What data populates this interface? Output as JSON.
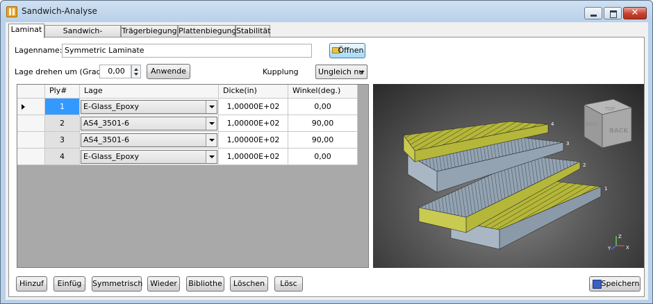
{
  "window": {
    "title": "Sandwich-Analyse",
    "icon": "app-icon",
    "controls": [
      "minimize-icon",
      "maximize-icon",
      "close-icon"
    ]
  },
  "tabs": [
    {
      "label": "Laminat",
      "active": true
    },
    {
      "label": "Sandwich-Geometrie",
      "active": false
    },
    {
      "label": "Trägerbiegung",
      "active": false
    },
    {
      "label": "Plattenbiegung",
      "active": false
    },
    {
      "label": "Stabilität",
      "active": false
    }
  ],
  "form": {
    "lagenname_label": "Lagenname:",
    "lagenname_value": "Symmetric Laminate",
    "open_button": "Öffnen",
    "rotate_label": "Lage drehen um (Grad)",
    "rotate_value": "0,00",
    "apply_button": "Anwende",
    "kupplung_label": "Kupplung",
    "kupplung_value": "Ungleich nu"
  },
  "table": {
    "columns": [
      "Ply#",
      "Lage",
      "Dicke(in)",
      "Winkel(deg.)"
    ],
    "rows": [
      {
        "ply": "1",
        "lage": "E-Glass_Epoxy",
        "dicke": "1,00000E+02",
        "winkel": "0,00",
        "selected": true
      },
      {
        "ply": "2",
        "lage": "AS4_3501-6",
        "dicke": "1,00000E+02",
        "winkel": "90,00",
        "selected": false
      },
      {
        "ply": "3",
        "lage": "AS4_3501-6",
        "dicke": "1,00000E+02",
        "winkel": "90,00",
        "selected": false
      },
      {
        "ply": "4",
        "lage": "E-Glass_Epoxy",
        "dicke": "1,00000E+02",
        "winkel": "0,00",
        "selected": false
      }
    ]
  },
  "viewer": {
    "cube_labels": {
      "top": "TOP",
      "back": "BACK",
      "right": "RIGHT"
    },
    "ply_labels": [
      "1",
      "2",
      "3",
      "4"
    ],
    "axis_labels": {
      "z": "Z",
      "y": "Y",
      "x": "X"
    },
    "colors": {
      "glass": "#b5b73a",
      "carbon": "#93a3b2"
    }
  },
  "bottom_buttons": {
    "hinzuf": "Hinzuf",
    "einfueg": "Einfüg",
    "symmetrisch": "Symmetrisch",
    "wieder": "Wieder",
    "bibliothe": "Bibliothe",
    "loeschen": "Löschen",
    "loesc": "Lösc",
    "speichern": "Speichern"
  }
}
